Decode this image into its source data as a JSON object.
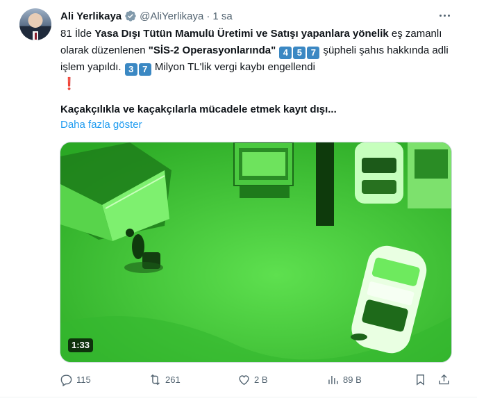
{
  "author": {
    "name": "Ali Yerlikaya",
    "handle": "@AliYerlikaya",
    "separator": "·",
    "time": "1 sa"
  },
  "tweet": {
    "line1_a": "81 İlde ",
    "line1_b": "Yasa Dışı Tütün Mamulü Üretimi ve Satışı yapanlara yönelik",
    "line1_c": " eş zamanlı olarak düzenlenen ",
    "line1_d": "\"SİS-2 Operasyonlarında\"",
    "count_digits": [
      "4",
      "5",
      "7"
    ],
    "line1_e": " şüpheli şahıs hakkında adli işlem yapıldı. ",
    "loss_digits": [
      "3",
      "7"
    ],
    "line1_f": " Milyon TL'lik vergi kaybı engellendi",
    "exclamation": "❗",
    "para2": "Kaçakçılıkla ve kaçakçılarla mücadele etmek kayıt dışı...",
    "show_more": "Daha fazla göster"
  },
  "media": {
    "duration": "1:33"
  },
  "actions": {
    "replies": "115",
    "retweets": "261",
    "likes": "2 B",
    "views": "89 B"
  },
  "colors": {
    "link": "#1d9bf0",
    "text": "#0f1419",
    "muted": "#536471",
    "keycap": "#3b88c3",
    "nightvision": "#3fd13a"
  },
  "icons": [
    "verified-badge-icon",
    "more-icon",
    "reply-icon",
    "retweet-icon",
    "like-icon",
    "views-icon",
    "bookmark-icon",
    "share-icon"
  ]
}
